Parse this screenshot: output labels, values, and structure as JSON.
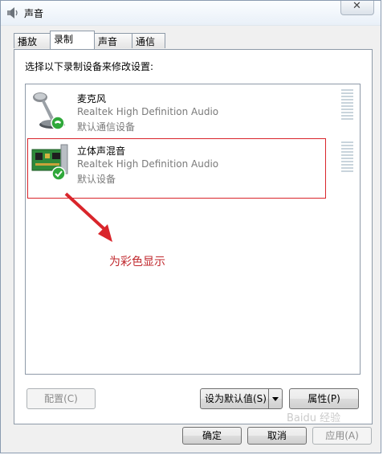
{
  "window": {
    "title": "声音",
    "close_symbol": "✕"
  },
  "tabs": [
    {
      "label": "播放",
      "active": false
    },
    {
      "label": "录制",
      "active": true
    },
    {
      "label": "声音",
      "active": false
    },
    {
      "label": "通信",
      "active": false
    }
  ],
  "panel": {
    "instruction": "选择以下录制设备来修改设置:"
  },
  "devices": [
    {
      "name": "麦克风",
      "driver": "Realtek High Definition Audio",
      "status": "默认通信设备",
      "icon": "microphone-icon",
      "badge": "phone-badge-icon"
    },
    {
      "name": "立体声混音",
      "driver": "Realtek High Definition Audio",
      "status": "默认设备",
      "icon": "sound-card-icon",
      "badge": "check-badge-icon"
    }
  ],
  "annotation": {
    "text": "为彩色显示",
    "color": "#c0282d"
  },
  "buttons": {
    "configure": "配置(C)",
    "set_default": "设为默认值(S)",
    "properties": "属性(P)",
    "ok": "确定",
    "cancel": "取消",
    "apply": "应用(A)"
  },
  "watermark": "Baidu 经验"
}
